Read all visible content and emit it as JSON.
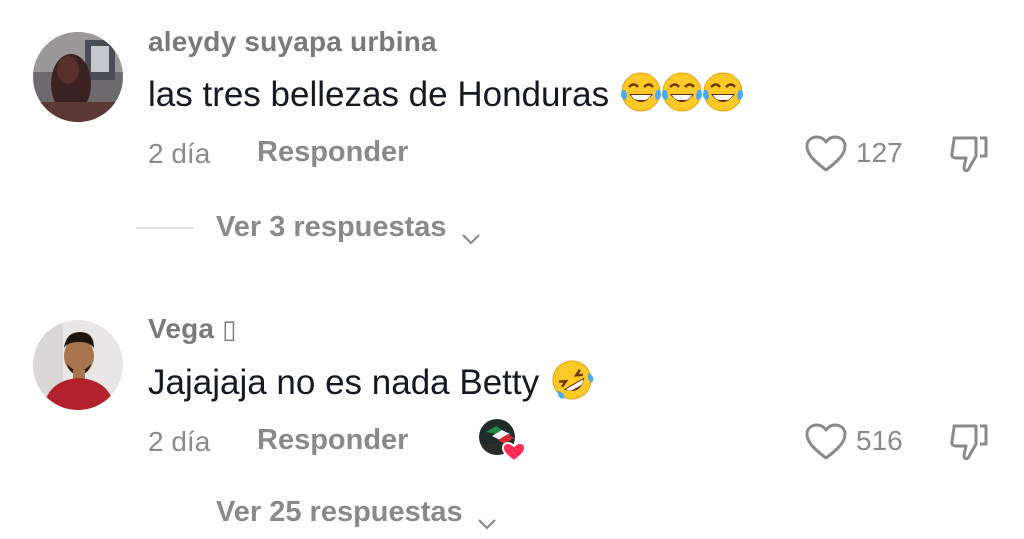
{
  "comments": [
    {
      "username": "aleydy suyapa urbina",
      "text": "las tres bellezas de Honduras",
      "emojis": [
        "tears-of-joy-emoji",
        "tears-of-joy-emoji",
        "tears-of-joy-emoji"
      ],
      "date": "2 día",
      "reply_label": "Responder",
      "likes": "127",
      "replies_label": "Ver 3 respuestas"
    },
    {
      "username": "Vega",
      "username_suffix": "▯",
      "text": "Jajajaja no es nada Betty",
      "emojis": [
        "rolling-on-floor-laughing-emoji"
      ],
      "date": "2 día",
      "reply_label": "Responder",
      "likes": "516",
      "replies_label": "Ver 25 respuestas",
      "creator_liked": true
    }
  ],
  "colors": {
    "username": "#7a7a7a",
    "text": "#161823",
    "meta": "#8a8a8a",
    "creator_heart": "#fe2c55"
  },
  "icons": {
    "like": "heart-outline-icon",
    "dislike": "thumbs-down-outline-icon",
    "expand": "chevron-down-icon"
  }
}
